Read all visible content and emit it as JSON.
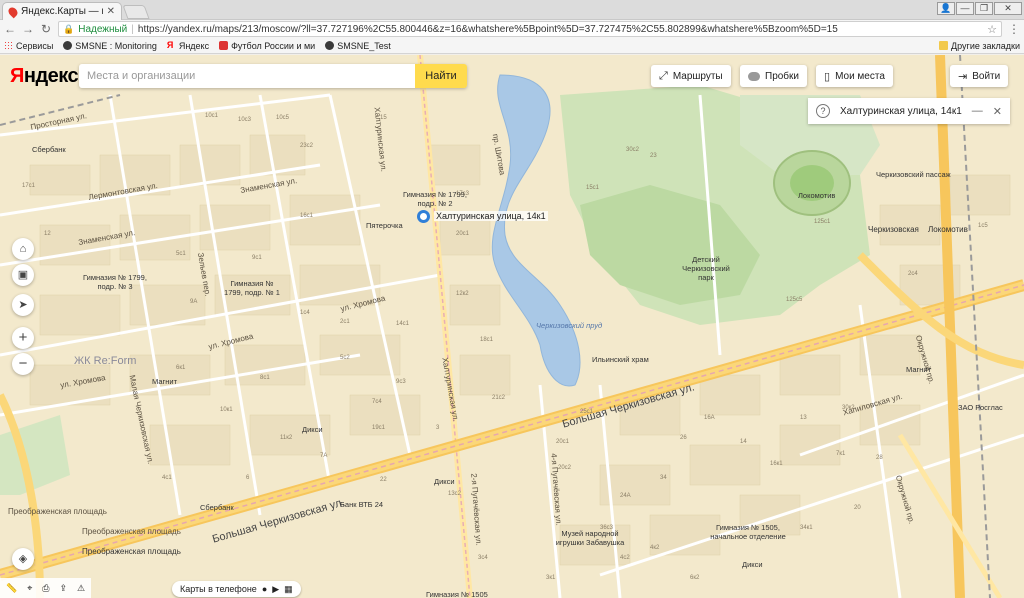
{
  "browser": {
    "tab_title": "Яндекс.Карты — подро",
    "tab_close": "✕",
    "secure_label": "Надежный",
    "url": "https://yandex.ru/maps/213/moscow/?ll=37.727196%2C55.800446&z=16&whatshere%5Bpoint%5D=37.727475%2C55.802899&whatshere%5Bzoom%5D=15",
    "bookmarks": [
      "Сервисы",
      "SMSNE : Monitoring",
      "Яндекс",
      "Футбол России и ми",
      "SMSNE_Test"
    ],
    "other_bookmarks": "Другие закладки"
  },
  "map_ui": {
    "logo_first": "Я",
    "logo_rest": "ндекс",
    "search_placeholder": "Места и организации",
    "search_button": "Найти",
    "routes": "Маршруты",
    "traffic": "Пробки",
    "my_places": "Мои места",
    "login": "Войти",
    "card_title": "Халтуринская улица, 14к1",
    "card_question": "?",
    "card_minimize": "—",
    "card_close": "✕",
    "pin_label": "Халтуринская улица, 14к1",
    "phone_promo": "Карты в телефоне"
  },
  "map_labels": {
    "streets": [
      "Просторная ул.",
      "Лермонтовская ул.",
      "Знаменская ул.",
      "Знаменская ул.",
      "ул. Хромова",
      "ул. Хромова",
      "ул. Хромова",
      "Халтуринская ул.",
      "Халтуринская ул.",
      "Большая Черкизовская ул.",
      "Большая Черкизовская ул.",
      "Малая Черкизовская ул.",
      "Преображенская площадь",
      "Преображенская площадь",
      "Хапиловская ул.",
      "Окружной пр.",
      "Окружной пр.",
      "2-я Пугачёвская ул.",
      "4-я Пугачёвская ул.",
      "Зельев пер.",
      "пр. Шитова"
    ],
    "pois": [
      "Сбербанк",
      "Гимназия № 1799, подр. № 2",
      "Пятерочка",
      "Гимназия № 1799, подр. № 3",
      "Гимназия № 1799, подр. № 1",
      "ЖК Re:Form",
      "Магнит",
      "Дикси",
      "Банк ВТБ 24",
      "Детский Черкизовский парк",
      "Черкизовский пруд",
      "Ильинский храм",
      "Локомотив",
      "Черкизовский пассаж",
      "Черкизовская",
      "Локомотив",
      "Магнит",
      "ЗАО Росглас",
      "Гимназия № 1505, начальное отделение",
      "Музей народной игрушки Забавушка",
      "Дикси",
      "Дикси",
      "Гимназия № 1505",
      "Преображенская площадь",
      "Сбербанк"
    ],
    "houses": [
      "10c1",
      "10c3",
      "10c5",
      "17c1",
      "12",
      "5c1",
      "9c1",
      "23c2",
      "15",
      "16с1",
      "17с3",
      "20с1",
      "1c4",
      "2c1",
      "8c1",
      "5c2",
      "7c4",
      "14c1",
      "12к2",
      "18с1",
      "19c1",
      "21c2",
      "11к2",
      "9c3",
      "3",
      "7A",
      "9A",
      "6к1",
      "10к1",
      "13c2",
      "22",
      "6",
      "4c1",
      "30c2",
      "23",
      "15с1",
      "125с5",
      "125c1",
      "1c5",
      "2c4",
      "20c1",
      "20c2",
      "24A",
      "26",
      "14",
      "13",
      "16к1",
      "7к1",
      "28",
      "25c1",
      "16A",
      "34",
      "36c3",
      "3к1",
      "4к2",
      "3c4",
      "6к2",
      "34к1",
      "20",
      "30к2",
      "4c2"
    ]
  }
}
